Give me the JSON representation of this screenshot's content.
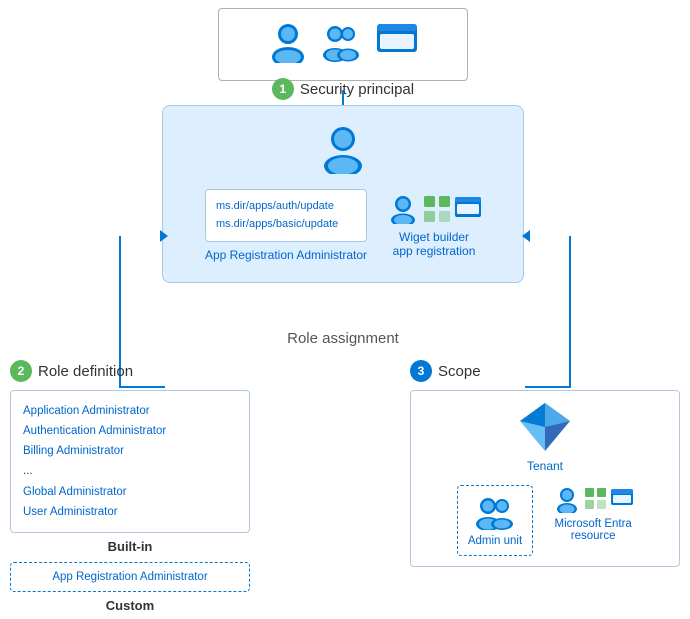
{
  "security_principal": {
    "label": "Security principal",
    "badge": "1"
  },
  "role_assignment": {
    "label": "Role assignment",
    "permissions": [
      "ms.dir/apps/auth/update",
      "ms.dir/apps/basic/update"
    ],
    "app_reg_label": "App Registration Administrator",
    "widget_label": "Wiget builder\napp registration"
  },
  "role_definition": {
    "title": "Role definition",
    "badge": "2",
    "built_in_roles": [
      "Application Administrator",
      "Authentication Administrator",
      "Billing Administrator",
      "...",
      "Global Administrator",
      "User Administrator"
    ],
    "built_in_label": "Built-in",
    "custom_role": "App Registration Administrator",
    "custom_label": "Custom"
  },
  "scope": {
    "title": "Scope",
    "badge": "3",
    "tenant_label": "Tenant",
    "admin_unit_label": "Admin unit",
    "entra_label": "Microsoft Entra\nresource"
  },
  "colors": {
    "blue": "#0078d4",
    "light_blue_bg": "#ddeeff",
    "green_badge": "#5cb85c",
    "link_blue": "#0066cc",
    "border_blue": "#a8c8e8"
  }
}
